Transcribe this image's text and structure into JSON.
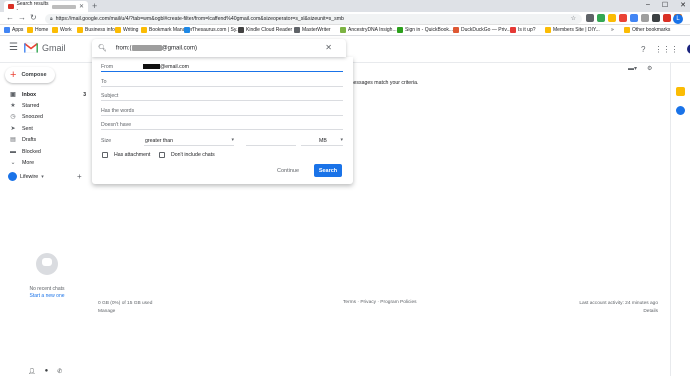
{
  "browser": {
    "tab_title": "Search results - ",
    "new_tab": "+",
    "window_controls": [
      "–",
      "☐",
      "✕"
    ],
    "url": "https://mail.google.com/mail/u/4/?tab=wm&ogbl#create-filter/from=lcaffend%40gmail.com&sizeoperator=s_sl&sizeunit=s_smb",
    "account_initial": "L"
  },
  "bookmarks": [
    {
      "label": "Apps",
      "color": "#4285f4"
    },
    {
      "label": "Home",
      "color": "#fbbc04"
    },
    {
      "label": "Work",
      "color": "#fbbc04"
    },
    {
      "label": "Business info",
      "color": "#fbbc04"
    },
    {
      "label": "Writing",
      "color": "#fbbc04"
    },
    {
      "label": "Bookmark Manager",
      "color": "#fbbc04"
    },
    {
      "label": "Thesaurus.com | Sy...",
      "color": "#1e88e5"
    },
    {
      "label": "Kindle Cloud Reader",
      "color": "#424242"
    },
    {
      "label": "MasterWriter",
      "color": "#5f6368"
    },
    {
      "label": "AncestryDNA Insigh...",
      "color": "#7cb342"
    },
    {
      "label": "Sign in - QuickBook...",
      "color": "#2ca01c"
    },
    {
      "label": "DuckDuckGo — Priv...",
      "color": "#de5833"
    },
    {
      "label": "Is it up?",
      "color": "#e53935"
    },
    {
      "label": "Members Site | DIY...",
      "color": "#fbbc04"
    },
    {
      "label": "»",
      "color": ""
    },
    {
      "label": "Other bookmarks",
      "color": "#fbbc04"
    }
  ],
  "gmail": {
    "app_name": "Gmail",
    "account_initial": "L",
    "compose_label": "Compose",
    "nav": [
      {
        "label": "Inbox",
        "icon": "inbox-icon",
        "glyph": "▣",
        "count": "3",
        "bold": true
      },
      {
        "label": "Starred",
        "icon": "star-icon",
        "glyph": "★",
        "count": "",
        "bold": false
      },
      {
        "label": "Snoozed",
        "icon": "clock-icon",
        "glyph": "◷",
        "count": "",
        "bold": false
      },
      {
        "label": "Sent",
        "icon": "send-icon",
        "glyph": "➤",
        "count": "",
        "bold": false
      },
      {
        "label": "Drafts",
        "icon": "draft-icon",
        "glyph": "▤",
        "count": "",
        "bold": false
      },
      {
        "label": "Blocked",
        "icon": "folder-icon",
        "glyph": "▬",
        "count": "",
        "bold": false
      },
      {
        "label": "More",
        "icon": "chevron-down-icon",
        "glyph": "⌄",
        "count": "",
        "bold": false
      }
    ],
    "hangouts_user": "Lifewire",
    "no_recent_chats": "No recent chats",
    "start_new_one": "Start a new one",
    "no_match_text": "ng messages match your criteria.",
    "storage_text": "0 GB (0%) of 15 GB used",
    "manage_text": "Manage",
    "footer_links": "Terms · Privacy · Program Policies",
    "last_activity": "Last account activity: 24 minutes ago",
    "details_text": "Details"
  },
  "search": {
    "query_prefix": "from:(",
    "query_suffix": "@gmail.com)",
    "fields": {
      "from_label": "From",
      "from_value_suffix": "@email.com",
      "to_label": "To",
      "subject_label": "Subject",
      "has_words_label": "Has the words",
      "doesnt_have_label": "Doesn't have",
      "size_label": "Size",
      "size_operator": "greater than",
      "size_unit": "MB"
    },
    "has_attachment_label": "Has attachment",
    "dont_include_chats_label": "Don't include chats",
    "continue_label": "Continue",
    "search_label": "Search"
  },
  "colors": {
    "accent": "#1a73e8",
    "gmail_red": "#ea4335"
  }
}
